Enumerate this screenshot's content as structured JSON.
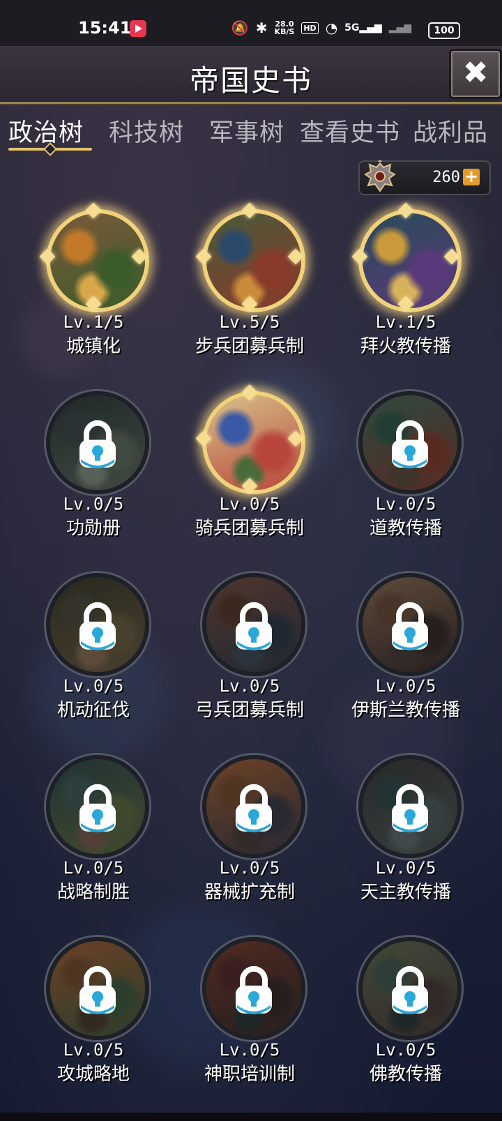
{
  "status_bar": {
    "time": "15:41",
    "speed_value": "28.0",
    "speed_unit": "KB/S",
    "hd": "HD",
    "network": "5G",
    "battery": "100"
  },
  "header": {
    "title": "帝国史书",
    "close_icon": "close-icon"
  },
  "tabs": [
    {
      "label": "政治树",
      "active": true
    },
    {
      "label": "科技树",
      "active": false
    },
    {
      "label": "军事树",
      "active": false
    },
    {
      "label": "查看史书",
      "active": false
    },
    {
      "label": "战利品",
      "active": false
    }
  ],
  "resource": {
    "icon": "double-eagle-emblem-icon",
    "value": "260",
    "plus_icon": "plus-icon"
  },
  "nodes": [
    {
      "level": "Lv.1/5",
      "name": "城镇化",
      "locked": false
    },
    {
      "level": "Lv.5/5",
      "name": "步兵团募兵制",
      "locked": false
    },
    {
      "level": "Lv.1/5",
      "name": "拜火教传播",
      "locked": false
    },
    {
      "level": "Lv.0/5",
      "name": "功勋册",
      "locked": true
    },
    {
      "level": "Lv.0/5",
      "name": "骑兵团募兵制",
      "locked": false
    },
    {
      "level": "Lv.0/5",
      "name": "道教传播",
      "locked": true
    },
    {
      "level": "Lv.0/5",
      "name": "机动征伐",
      "locked": true
    },
    {
      "level": "Lv.0/5",
      "name": "弓兵团募兵制",
      "locked": true
    },
    {
      "level": "Lv.0/5",
      "name": "伊斯兰教传播",
      "locked": true
    },
    {
      "level": "Lv.0/5",
      "name": "战略制胜",
      "locked": true
    },
    {
      "level": "Lv.0/5",
      "name": "器械扩充制",
      "locked": true
    },
    {
      "level": "Lv.0/5",
      "name": "天主教传播",
      "locked": true
    },
    {
      "level": "Lv.0/5",
      "name": "攻城略地",
      "locked": true
    },
    {
      "level": "Lv.0/5",
      "name": "神职培训制",
      "locked": true
    },
    {
      "level": "Lv.0/5",
      "name": "佛教传播",
      "locked": true
    }
  ],
  "colors": {
    "accent_gold": "#e6c46a",
    "lock_blue": "#2aa8d8",
    "plus_orange": "#e59a2a"
  }
}
